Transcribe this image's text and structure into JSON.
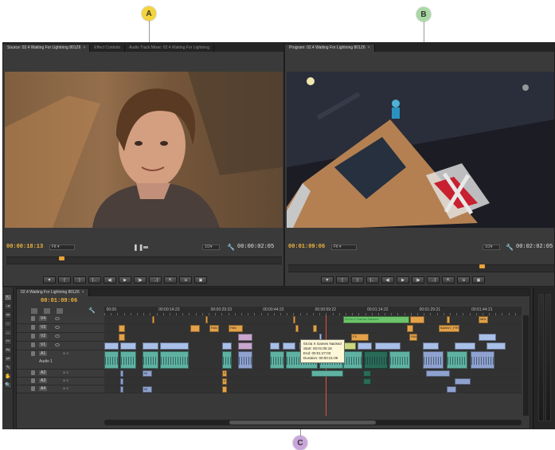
{
  "callouts": [
    {
      "letter": "A",
      "color": "#f3d43a"
    },
    {
      "letter": "B",
      "color": "#a8d9a4"
    },
    {
      "letter": "C",
      "color": "#c9a6dc"
    }
  ],
  "source_monitor": {
    "tabs": [
      {
        "label": "Source: 02.4 Waiting For Lightning 801Z6",
        "active": true
      },
      {
        "label": "Effect Controls",
        "active": false
      },
      {
        "label": "Audio Track Mixer: 02.4 Waiting For Lightning",
        "active": false
      }
    ],
    "timecode": "00:00:18:13",
    "fit_label": "Fit",
    "resolution": "1/2",
    "duration": "00:00:02:05",
    "playhead_position": 0.19
  },
  "program_monitor": {
    "tabs": [
      {
        "label": "Program: 02.4 Waiting For Lightning 801Z6",
        "active": true
      }
    ],
    "timecode": "00:01:09:06",
    "fit_label": "Fit",
    "resolution": "1/2",
    "duration": "00:02:02:05",
    "playhead_position": 0.72
  },
  "transport_buttons": [
    "▼",
    "{",
    "}",
    "{←",
    "◀|",
    "▶",
    "|▶",
    "→}",
    "⇱",
    "⇲",
    "▣"
  ],
  "tools": [
    "selection-tool",
    "track-select-tool",
    "ripple-edit-tool",
    "rolling-edit-tool",
    "rate-stretch-tool",
    "razor-tool",
    "slip-tool",
    "slide-tool",
    "pen-tool",
    "hand-tool",
    "zoom-tool"
  ],
  "timeline": {
    "tab_label": "02.4 Waiting For Lightning 801Z6",
    "timecode": "00:01:09:06",
    "ruler_labels": [
      "00:00",
      "00:00:14:23",
      "00:00:29:23",
      "00:00:44:22",
      "00:00:59:22",
      "00:01:14:22",
      "00:01:29:21",
      "00:01:44:21"
    ],
    "playhead_position": 0.53,
    "video_tracks": [
      "V4",
      "V3",
      "V2",
      "V1"
    ],
    "audio_tracks": [
      "A1",
      "A2",
      "A3",
      "A4"
    ],
    "audio1_name": "Audio 1",
    "clip_labels": {
      "green_title": "03.4a X Games Nacked",
      "pan1": "PAN",
      "pan2": "PAN",
      "pan3": "PAN",
      "fx": "FX",
      "banny": "BANNY_FRS",
      "mdl": "MDL",
      "ft": "FT",
      "ni": "NI"
    },
    "tooltip": {
      "name": "03.0a X Games Nacked",
      "start": "Start: 00:01:05:16",
      "end": "End: 00:01:27:03",
      "duration": "Duration: 00:00:21:09"
    }
  }
}
